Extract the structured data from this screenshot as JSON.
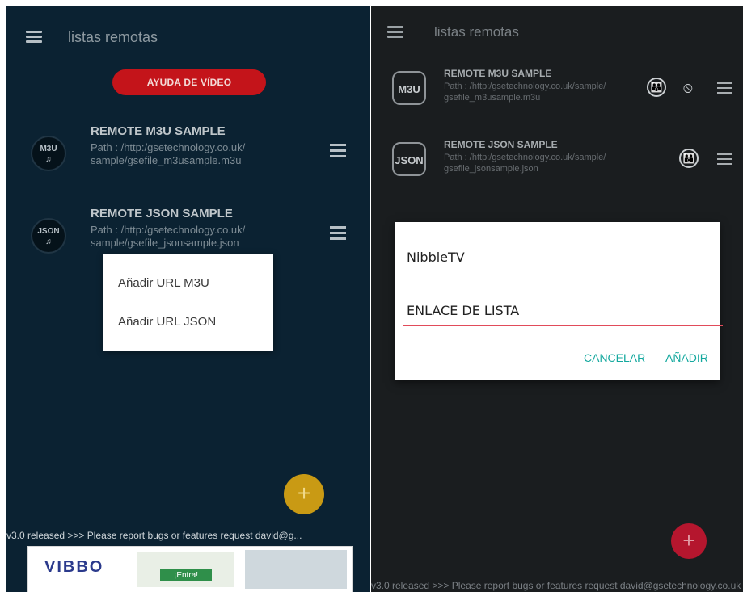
{
  "left": {
    "title": "listas remotas",
    "video_button": "AYUDA DE VÍDEO",
    "lists": [
      {
        "badge": "M3U",
        "name": "REMOTE M3U SAMPLE",
        "path": "Path : /http:/gsetechnology.co.uk/ sample/gsefile_m3usample.m3u"
      },
      {
        "badge": "JSON",
        "name": "REMOTE JSON SAMPLE",
        "path": "Path : /http:/gsetechnology.co.uk/ sample/gsefile_jsonsample.json"
      }
    ],
    "popup_menu": [
      "Añadir URL M3U",
      "Añadir URL JSON"
    ],
    "fab": "+",
    "ticker": "v3.0 released >>> Please report bugs or features request david@g...",
    "ad": {
      "logo": "VIBBO",
      "button": "¡Entra!"
    }
  },
  "right": {
    "title": "listas remotas",
    "lists": [
      {
        "badge": "M3U",
        "name": "REMOTE M3U SAMPLE",
        "path": "Path : /http:/gsetechnology.co.uk/sample/ gsefile_m3usample.m3u"
      },
      {
        "badge": "JSON",
        "name": "REMOTE JSON SAMPLE",
        "path": "Path : /http:/gsetechnology.co.uk/sample/ gsefile_jsonsample.json"
      }
    ],
    "dialog": {
      "name_value": "NibbleTV",
      "link_value": "ENLACE DE LISTA",
      "cancel": "CANCELAR",
      "add": "AÑADIR"
    },
    "fab": "+",
    "ticker": "v3.0 released >>> Please report bugs or features request david@gsetechnology.co.uk"
  },
  "colors": {
    "left_bg": "#0b2232",
    "right_bg": "#1a1d1f",
    "video_button": "#c4141a",
    "fab_left": "#c99a14",
    "fab_right": "#b5162e",
    "dialog_accent": "#13a89e",
    "field_focus": "#e14b5a"
  },
  "icons": [
    "menu-icon",
    "music-note-icon",
    "parental-icon",
    "hidden-eye-icon",
    "overflow-menu-icon",
    "plus-icon"
  ]
}
